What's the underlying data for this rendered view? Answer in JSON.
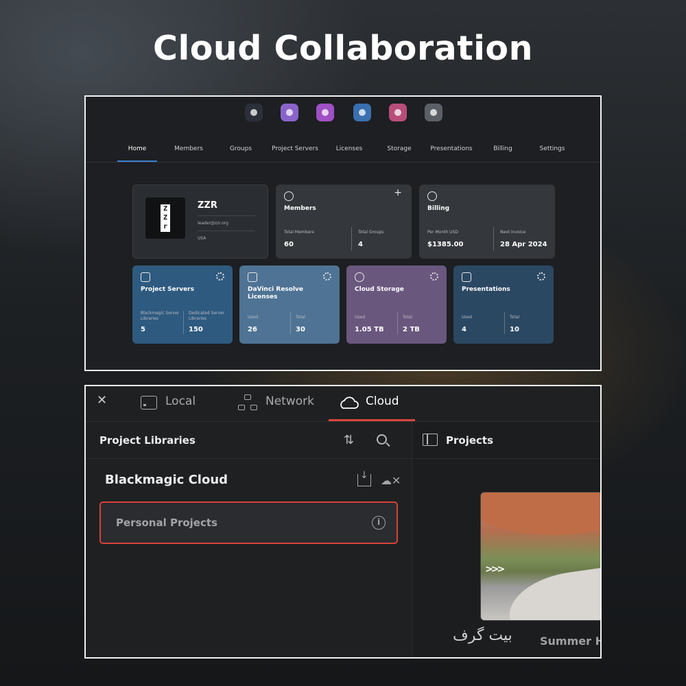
{
  "header": {
    "title": "Cloud Collaboration"
  },
  "dashboard": {
    "app_icons": [
      {
        "name": "davinci-resolve-icon",
        "color": "#2b2f3a"
      },
      {
        "name": "cloud-color-icon",
        "color": "#8a63c9"
      },
      {
        "name": "cloud-purple-icon",
        "color": "#a04fc4"
      },
      {
        "name": "fusion-icon",
        "color": "#3a6fb0"
      },
      {
        "name": "media-icon",
        "color": "#b94d7a"
      },
      {
        "name": "settings-icon",
        "color": "#5b5f66"
      }
    ],
    "nav": [
      "Home",
      "Members",
      "Groups",
      "Project Servers",
      "Licenses",
      "Storage",
      "Presentations",
      "Billing",
      "Settings"
    ],
    "org": {
      "logo": "ZZR",
      "name": "ZZR",
      "email": "leader@zzr.org",
      "country": "USA"
    },
    "members": {
      "title": "Members",
      "total_members_label": "Total Members",
      "total_members": "60",
      "total_groups_label": "Total Groups",
      "total_groups": "4"
    },
    "billing": {
      "title": "Billing",
      "per_month_label": "Per Month USD",
      "per_month": "$1385.00",
      "next_invoice_label": "Next Invoice",
      "next_invoice": "28 Apr 2024"
    },
    "tiles": [
      {
        "title": "Project Servers",
        "color": "#2e5a7f",
        "l1": "Blackmagic Server Libraries",
        "v1": "5",
        "l2": "Dedicated Server Libraries",
        "v2": "150"
      },
      {
        "title": "DaVinci Resolve Licenses",
        "color": "#4f7394",
        "l1": "Used",
        "v1": "26",
        "l2": "Total",
        "v2": "30"
      },
      {
        "title": "Cloud Storage",
        "color": "#6a577e",
        "l1": "Used",
        "v1": "1.05 TB",
        "l2": "Total",
        "v2": "2 TB"
      },
      {
        "title": "Presentations",
        "color": "#2b4863",
        "l1": "Used",
        "v1": "4",
        "l2": "Total",
        "v2": "10"
      }
    ]
  },
  "browser": {
    "tabs": [
      "Local",
      "Network",
      "Cloud"
    ],
    "active_tab": "Cloud",
    "left_header": "Project Libraries",
    "library": "Blackmagic Cloud",
    "item": "Personal Projects",
    "right_header": "Projects",
    "clip_name": "Summer H"
  },
  "watermark": "بیت گرف"
}
